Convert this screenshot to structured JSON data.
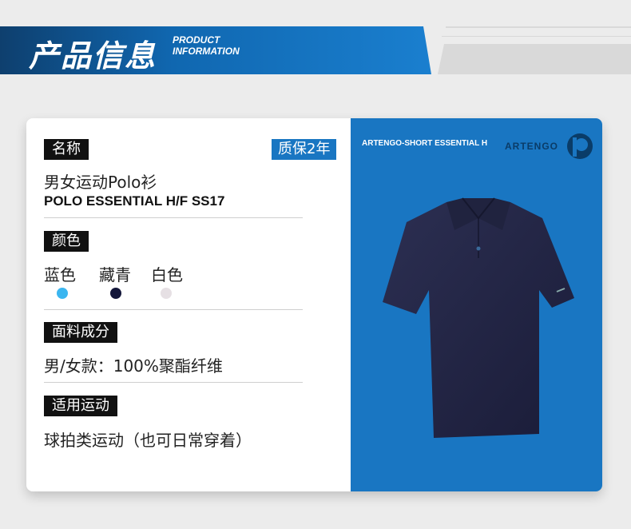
{
  "banner": {
    "title": "产品信息",
    "sub_line1": "PRODUCT",
    "sub_line2": "INFORMATION"
  },
  "card": {
    "name_tag": "名称",
    "warranty": "质保2年",
    "product_cn": "男女运动Polo衫",
    "product_en": "POLO ESSENTIAL H/F  SS17",
    "color_tag": "颜色",
    "colors": [
      {
        "label": "蓝色",
        "hex": "#3bb6f0"
      },
      {
        "label": "藏青",
        "hex": "#14173a"
      },
      {
        "label": "白色",
        "hex": "#e6e0e4"
      }
    ],
    "fabric_tag": "面料成分",
    "fabric": "男/女款：100%聚酯纤维",
    "usage_tag": "适用运动",
    "usage": "球拍类运动（也可日常穿着）"
  },
  "image_panel": {
    "brand_text": "ARTENGO-SHORT ESSENTIAL H",
    "logo_text": "ARTENGO",
    "shirt_icon": "polo-shirt-icon",
    "background": "#1976c2"
  }
}
